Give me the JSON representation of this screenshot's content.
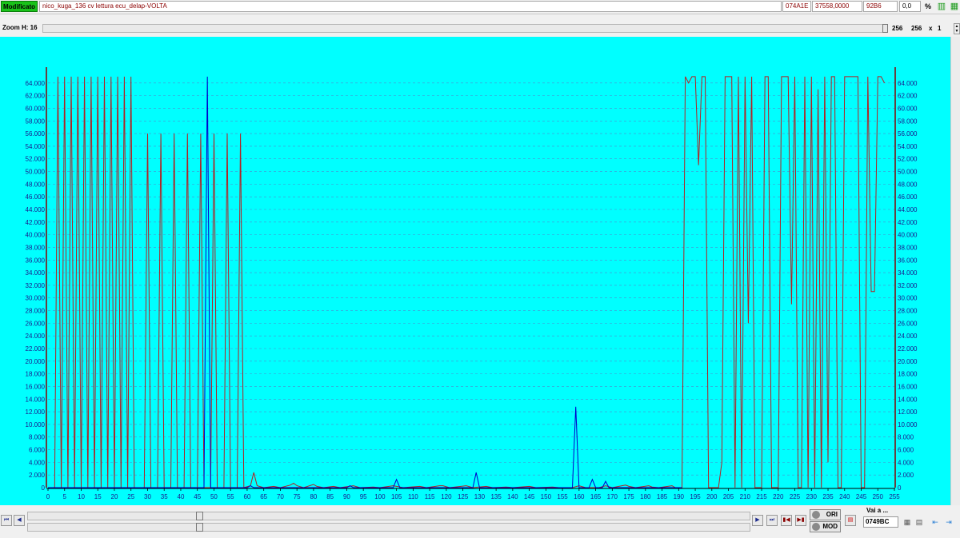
{
  "toolbar": {
    "status": "Modificato",
    "filename": "nico_kuga_136 cv lettura ecu_delap-VOLTA",
    "address": "074A1E",
    "value_dec": "37558,0000",
    "value_hex": "92B6",
    "value_factor": "0,0",
    "percent_label": "%"
  },
  "zoom": {
    "label": "Zoom H: 16",
    "width": "256",
    "height": "256",
    "multiplier_label": "x",
    "multiplier": "1"
  },
  "nav": {
    "first": "⏮",
    "prev": "◀",
    "next": "▶",
    "last": "⏭",
    "ori_label": "ORI",
    "mod_label": "MOD",
    "goto_label": "Vai a ...",
    "goto_value": "0749BC"
  },
  "colors": {
    "background": "#00ffff",
    "ori_line": "#b22222",
    "mod_line": "#0000cd",
    "axis": "#1a1a8c"
  },
  "chart_data": {
    "type": "line",
    "x_ticks": [
      0,
      5,
      10,
      15,
      20,
      25,
      30,
      35,
      40,
      45,
      50,
      55,
      60,
      65,
      70,
      75,
      80,
      85,
      90,
      95,
      100,
      105,
      110,
      115,
      120,
      125,
      130,
      135,
      140,
      145,
      150,
      155,
      160,
      165,
      170,
      175,
      180,
      185,
      190,
      195,
      200,
      205,
      210,
      215,
      220,
      225,
      230,
      235,
      240,
      245,
      250,
      255
    ],
    "y_ticks": [
      "0",
      "2.000",
      "4.000",
      "6.000",
      "8.000",
      "10.000",
      "12.000",
      "14.000",
      "16.000",
      "18.000",
      "20.000",
      "22.000",
      "24.000",
      "26.000",
      "28.000",
      "30.000",
      "32.000",
      "34.000",
      "36.000",
      "38.000",
      "40.000",
      "42.000",
      "44.000",
      "46.000",
      "48.000",
      "50.000",
      "52.000",
      "54.000",
      "56.000",
      "58.000",
      "60.000",
      "62.000",
      "64.000"
    ],
    "xlim": [
      0,
      255
    ],
    "ylim": [
      0,
      66000
    ],
    "grid": true,
    "series": [
      {
        "color": "#b22222",
        "points": [
          [
            0,
            0
          ],
          [
            2,
            0
          ],
          [
            3,
            65000
          ],
          [
            4,
            0
          ],
          [
            5,
            65000
          ],
          [
            6,
            0
          ],
          [
            7,
            65000
          ],
          [
            8,
            0
          ],
          [
            9,
            65000
          ],
          [
            10,
            0
          ],
          [
            11,
            65000
          ],
          [
            12,
            0
          ],
          [
            13,
            65000
          ],
          [
            14,
            0
          ],
          [
            15,
            65000
          ],
          [
            16,
            0
          ],
          [
            17,
            65000
          ],
          [
            18,
            0
          ],
          [
            19,
            65000
          ],
          [
            20,
            0
          ],
          [
            21,
            65000
          ],
          [
            22,
            0
          ],
          [
            23,
            65000
          ],
          [
            24,
            0
          ],
          [
            25,
            65000
          ],
          [
            26,
            0
          ],
          [
            29,
            0
          ],
          [
            30,
            56000
          ],
          [
            31,
            0
          ],
          [
            33,
            0
          ],
          [
            34,
            56000
          ],
          [
            35,
            0
          ],
          [
            37,
            0
          ],
          [
            38,
            56000
          ],
          [
            39,
            0
          ],
          [
            41,
            0
          ],
          [
            42,
            56000
          ],
          [
            43,
            0
          ],
          [
            45,
            0
          ],
          [
            46,
            56000
          ],
          [
            47,
            0
          ],
          [
            49,
            0
          ],
          [
            50,
            56000
          ],
          [
            51,
            0
          ],
          [
            53,
            0
          ],
          [
            54,
            56000
          ],
          [
            55,
            0
          ],
          [
            57,
            0
          ],
          [
            58,
            56000
          ],
          [
            59,
            0
          ],
          [
            61,
            300
          ],
          [
            62,
            2400
          ],
          [
            63,
            300
          ],
          [
            65,
            0
          ],
          [
            68,
            200
          ],
          [
            70,
            0
          ],
          [
            73,
            400
          ],
          [
            74,
            700
          ],
          [
            75,
            300
          ],
          [
            77,
            0
          ],
          [
            80,
            500
          ],
          [
            81,
            200
          ],
          [
            83,
            0
          ],
          [
            86,
            200
          ],
          [
            88,
            0
          ],
          [
            92,
            300
          ],
          [
            94,
            0
          ],
          [
            98,
            100
          ],
          [
            100,
            0
          ],
          [
            104,
            300
          ],
          [
            105,
            200
          ],
          [
            107,
            0
          ],
          [
            112,
            200
          ],
          [
            114,
            0
          ],
          [
            118,
            300
          ],
          [
            119,
            300
          ],
          [
            121,
            0
          ],
          [
            126,
            300
          ],
          [
            128,
            0
          ],
          [
            132,
            200
          ],
          [
            134,
            0
          ],
          [
            138,
            100
          ],
          [
            140,
            0
          ],
          [
            145,
            200
          ],
          [
            147,
            0
          ],
          [
            152,
            100
          ],
          [
            154,
            0
          ],
          [
            158,
            0
          ],
          [
            160,
            300
          ],
          [
            162,
            0
          ],
          [
            166,
            0
          ],
          [
            168,
            300
          ],
          [
            170,
            0
          ],
          [
            174,
            400
          ],
          [
            175,
            200
          ],
          [
            177,
            0
          ],
          [
            181,
            300
          ],
          [
            182,
            100
          ],
          [
            184,
            0
          ],
          [
            188,
            300
          ],
          [
            189,
            0
          ],
          [
            191,
            0
          ],
          [
            192,
            65000
          ],
          [
            193,
            64000
          ],
          [
            194,
            65000
          ],
          [
            195,
            65000
          ],
          [
            196,
            51000
          ],
          [
            197,
            65000
          ],
          [
            198,
            65000
          ],
          [
            199,
            0
          ],
          [
            202,
            0
          ],
          [
            203,
            4000
          ],
          [
            204,
            65000
          ],
          [
            205,
            65000
          ],
          [
            206,
            65000
          ],
          [
            207,
            0
          ],
          [
            208,
            65000
          ],
          [
            209,
            0
          ],
          [
            210,
            65000
          ],
          [
            211,
            26000
          ],
          [
            212,
            65000
          ],
          [
            213,
            0
          ],
          [
            214,
            0
          ],
          [
            215,
            0
          ],
          [
            216,
            65000
          ],
          [
            217,
            65000
          ],
          [
            218,
            0
          ],
          [
            219,
            0
          ],
          [
            220,
            0
          ],
          [
            221,
            65000
          ],
          [
            222,
            65000
          ],
          [
            223,
            65000
          ],
          [
            224,
            29000
          ],
          [
            225,
            65000
          ],
          [
            226,
            0
          ],
          [
            227,
            0
          ],
          [
            228,
            65000
          ],
          [
            229,
            0
          ],
          [
            230,
            65000
          ],
          [
            231,
            0
          ],
          [
            232,
            63000
          ],
          [
            233,
            0
          ],
          [
            234,
            65000
          ],
          [
            235,
            4000
          ],
          [
            236,
            65000
          ],
          [
            237,
            65000
          ],
          [
            238,
            0
          ],
          [
            239,
            0
          ],
          [
            240,
            65000
          ],
          [
            241,
            65000
          ],
          [
            242,
            65000
          ],
          [
            243,
            65000
          ],
          [
            244,
            65000
          ],
          [
            245,
            0
          ],
          [
            246,
            0
          ],
          [
            247,
            65000
          ],
          [
            248,
            31000
          ],
          [
            249,
            31000
          ],
          [
            250,
            65000
          ],
          [
            251,
            65000
          ],
          [
            252,
            64000
          ]
        ]
      },
      {
        "color": "#0000cd",
        "points": [
          [
            0,
            0
          ],
          [
            47,
            0
          ],
          [
            48,
            65000
          ],
          [
            49,
            0
          ],
          [
            60,
            0
          ],
          [
            61,
            300
          ],
          [
            62,
            0
          ],
          [
            90,
            0
          ],
          [
            91,
            300
          ],
          [
            92,
            0
          ],
          [
            104,
            0
          ],
          [
            105,
            1300
          ],
          [
            106,
            0
          ],
          [
            128,
            0
          ],
          [
            129,
            2400
          ],
          [
            130,
            0
          ],
          [
            158,
            0
          ],
          [
            159,
            12800
          ],
          [
            160,
            0
          ],
          [
            163,
            0
          ],
          [
            164,
            1300
          ],
          [
            165,
            0
          ],
          [
            167,
            0
          ],
          [
            168,
            1000
          ],
          [
            169,
            0
          ],
          [
            191,
            0
          ]
        ]
      }
    ]
  }
}
